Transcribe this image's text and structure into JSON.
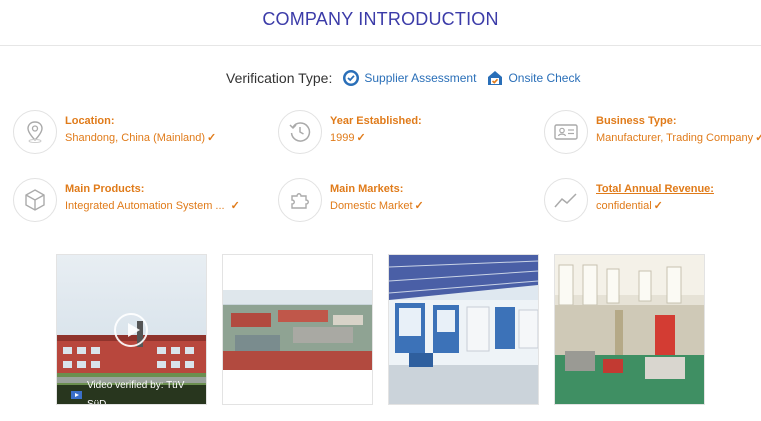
{
  "header": {
    "title": "COMPANY INTRODUCTION"
  },
  "verification": {
    "label": "Verification Type:",
    "badges": [
      {
        "label": "Supplier Assessment",
        "icon": "shield-check-icon"
      },
      {
        "label": "Onsite Check",
        "icon": "house-check-icon"
      }
    ]
  },
  "info": {
    "location": {
      "key": "Location:",
      "value": "Shandong, China (Mainland)",
      "icon": "location-pin-icon"
    },
    "year": {
      "key": "Year Established:",
      "value": "1999",
      "icon": "history-clock-icon"
    },
    "business": {
      "key": "Business Type:",
      "value": "Manufacturer, Trading Company",
      "icon": "id-card-icon"
    },
    "products": {
      "key": "Main Products:",
      "value": "Integrated Automation System ...",
      "icon": "box-icon"
    },
    "markets": {
      "key": "Main Markets:",
      "value": "Domestic Market",
      "icon": "puzzle-icon"
    },
    "revenue": {
      "key": "Total Annual Revenue:",
      "value": "confidential",
      "icon": "trend-chart-icon"
    }
  },
  "check_mark": "✓",
  "gallery": {
    "video_caption": "Video verified by: TüV SüD",
    "photos": [
      "company-building-video",
      "factory-aerial-view",
      "showroom-interior",
      "workshop-interior"
    ]
  },
  "colors": {
    "accent": "#e07b1a",
    "title": "#3b3ba8",
    "link": "#2a6fb8"
  }
}
